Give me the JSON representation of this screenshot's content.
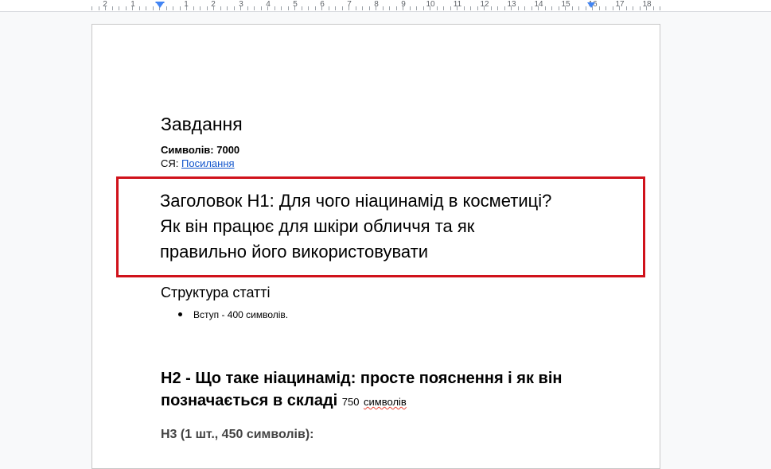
{
  "ruler": {
    "numbers": [
      "2",
      "1",
      "1",
      "2",
      "3",
      "4",
      "5",
      "6",
      "7",
      "8",
      "9",
      "10",
      "11",
      "12",
      "13",
      "14",
      "15",
      "16",
      "17",
      "18"
    ]
  },
  "doc": {
    "title": "Завдання",
    "symbols_line": "Символів: 7000",
    "sya_prefix": "СЯ: ",
    "sya_link": "Посилання",
    "h1_line1": "Заголовок Н1: Для чого ніацинамід в косметиці?",
    "h1_line2": "Як він працює для шкіри обличчя та як",
    "h1_line3": "правильно його використовувати",
    "structure_heading": "Структура статті",
    "bullet_intro": "Вступ - 400 символів.",
    "h2_text": "H2 - Що таке ніацинамід: просте пояснення і як він позначається в складі",
    "h2_count": "750",
    "h2_count_word": "символів",
    "h3_text": "Н3 (1 шт., 450 символів):"
  },
  "colors": {
    "highlight_border": "#d0121b",
    "link": "#1155cc",
    "ruler_marker": "#4285f4"
  }
}
